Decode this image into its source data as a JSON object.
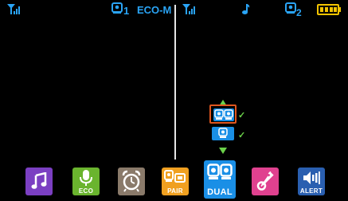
{
  "left_status": {
    "camera_number": "1",
    "mode_label": "ECO-M"
  },
  "right_status": {
    "camera_number": "2"
  },
  "dock": {
    "music": {
      "label": ""
    },
    "eco": {
      "label": "ECO"
    },
    "alarm": {
      "label": ""
    },
    "pair": {
      "label": "PAIR"
    },
    "dual": {
      "label": "DUAL"
    },
    "temperature": {
      "label": ""
    },
    "alert": {
      "label": "ALERT"
    }
  },
  "colors": {
    "accent_blue": "#2aa4f5",
    "music": "#7b3fc2",
    "eco": "#6ab42e",
    "alarm": "#8a7a6a",
    "pair": "#f0a020",
    "dual": "#1a8fe6",
    "temperature": "#e0418f",
    "alert": "#2a5fb0",
    "selection": "#e0561f",
    "check": "#6bd14a"
  }
}
